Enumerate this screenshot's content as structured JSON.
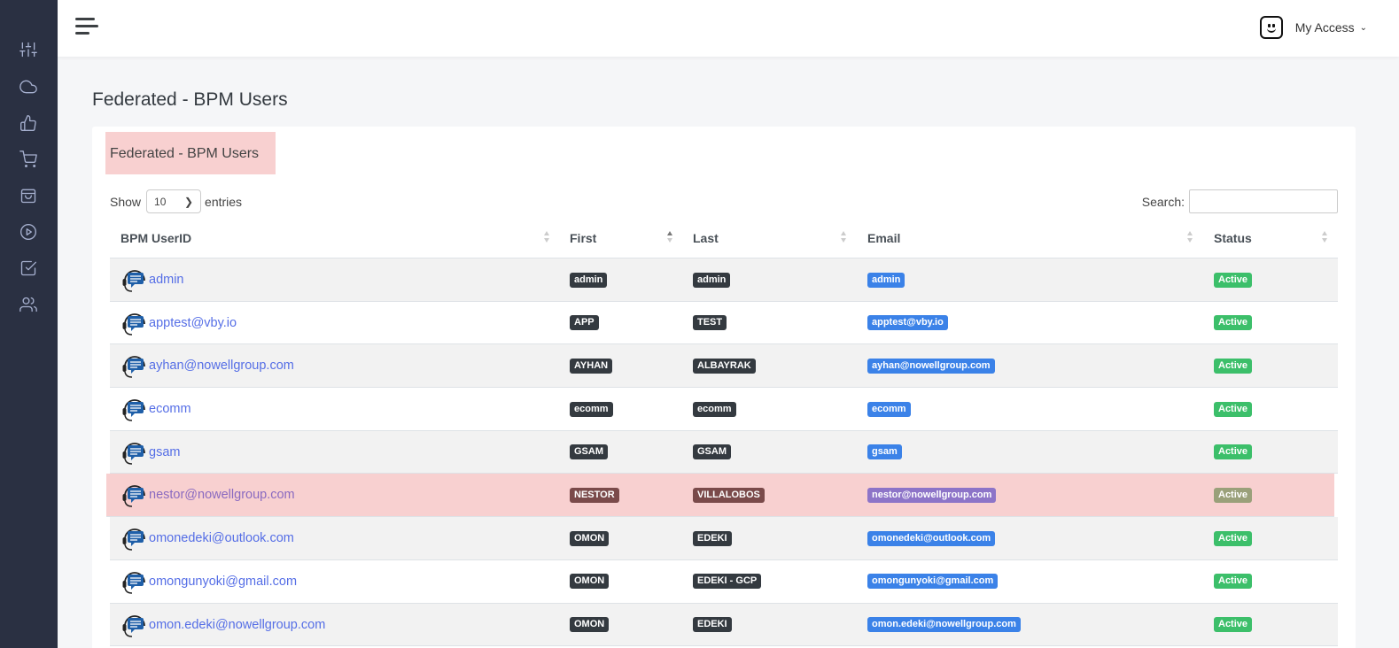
{
  "sidebar": {
    "icons": [
      "sliders-icon",
      "cloud-icon",
      "thumbs-up-icon",
      "cart-icon",
      "shopping-bag-icon",
      "play-circle-icon",
      "checkbox-icon",
      "users-icon"
    ]
  },
  "header": {
    "user_menu_label": "My Access"
  },
  "page": {
    "title": "Federated - BPM Users",
    "card_title": "Federated - BPM Users"
  },
  "table_controls": {
    "show_label": "Show",
    "entries_value": "10",
    "entries_label": "entries",
    "search_label": "Search:",
    "search_value": ""
  },
  "table": {
    "columns": [
      "BPM UserID",
      "First",
      "Last",
      "Email",
      "Status"
    ],
    "sorted_column": "First",
    "rows": [
      {
        "userid": "admin",
        "first": "admin",
        "last": "admin",
        "email": "admin",
        "status": "Active"
      },
      {
        "userid": "apptest@vby.io",
        "first": "APP",
        "last": "TEST",
        "email": "apptest@vby.io",
        "status": "Active"
      },
      {
        "userid": "ayhan@nowellgroup.com",
        "first": "AYHAN",
        "last": "ALBAYRAK",
        "email": "ayhan@nowellgroup.com",
        "status": "Active"
      },
      {
        "userid": "ecomm",
        "first": "ecomm",
        "last": "ecomm",
        "email": "ecomm",
        "status": "Active"
      },
      {
        "userid": "gsam",
        "first": "GSAM",
        "last": "GSAM",
        "email": "gsam",
        "status": "Active"
      },
      {
        "userid": "nestor@nowellgroup.com",
        "first": "NESTOR",
        "last": "VILLALOBOS",
        "email": "nestor@nowellgroup.com",
        "status": "Active",
        "highlighted": true
      },
      {
        "userid": "omonedeki@outlook.com",
        "first": "OMON",
        "last": "EDEKI",
        "email": "omonedeki@outlook.com",
        "status": "Active"
      },
      {
        "userid": "omongunyoki@gmail.com",
        "first": "OMON",
        "last": "EDEKI - GCP",
        "email": "omongunyoki@gmail.com",
        "status": "Active"
      },
      {
        "userid": "omon.edeki@nowellgroup.com",
        "first": "OMON",
        "last": "EDEKI",
        "email": "omon.edeki@nowellgroup.com",
        "status": "Active"
      }
    ]
  },
  "colors": {
    "sidebar_bg": "#2a3042",
    "link": "#556ee6",
    "badge_dark": "#343a40",
    "badge_blue": "#3b82e8",
    "badge_green": "#3cbf6a",
    "highlight": "#f8d0d0"
  }
}
